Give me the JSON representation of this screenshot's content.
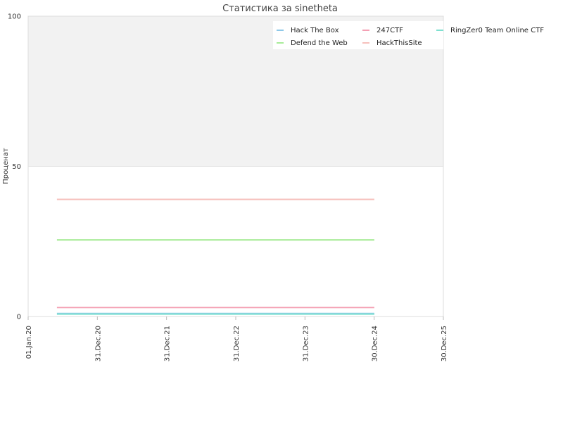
{
  "chart_data": {
    "type": "line",
    "title": "Статистика за sinetheta",
    "xlabel": "",
    "ylabel": "Проценат",
    "x_ticks": [
      "01.Jan.20",
      "31.Dec.20",
      "31.Dec.21",
      "31.Dec.22",
      "31.Dec.23",
      "30.Dec.24",
      "30.Dec.25"
    ],
    "xlim": [
      "2020-01-01",
      "2025-12-30"
    ],
    "ylim": [
      0,
      100
    ],
    "y_ticks": [
      0,
      50,
      100
    ],
    "legend_position": "top-right",
    "shaded_band": [
      50,
      100
    ],
    "series": [
      {
        "name": "Hack The Box",
        "color": "#8ec8e8",
        "x": [
          "2020-06-01",
          "2024-12-31"
        ],
        "y": [
          1,
          1
        ]
      },
      {
        "name": "247CTF",
        "color": "#f4a0b4",
        "x": [
          "2020-06-01",
          "2024-12-31"
        ],
        "y": [
          3,
          3
        ]
      },
      {
        "name": "RingZer0 Team Online CTF",
        "color": "#7ee0d0",
        "x": [
          "2020-06-01",
          "2024-12-31"
        ],
        "y": [
          0.8,
          0.8
        ]
      },
      {
        "name": "Defend the Web",
        "color": "#a8ec98",
        "x": [
          "2020-06-01",
          "2024-12-31"
        ],
        "y": [
          25.5,
          25.5
        ]
      },
      {
        "name": "HackThisSite",
        "color": "#f6c0bc",
        "x": [
          "2020-06-01",
          "2024-12-31"
        ],
        "y": [
          39,
          39
        ]
      }
    ]
  }
}
